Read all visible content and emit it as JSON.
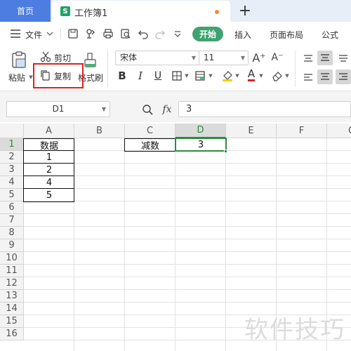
{
  "tabs": {
    "home": "首页",
    "doc_title": "工作簿1",
    "doc_logo": "S",
    "add": "+"
  },
  "menu": {
    "file": "文件",
    "start": "开始",
    "insert": "插入",
    "page_layout": "页面布局",
    "formula": "公式"
  },
  "ribbon": {
    "paste": "粘贴",
    "cut": "剪切",
    "copy": "复制",
    "format_painter": "格式刷",
    "font_name": "宋体",
    "font_size": "11",
    "bold": "B",
    "italic": "I",
    "underline": "U",
    "font_color": "A",
    "grow_font": "A⁺",
    "shrink_font": "A⁻"
  },
  "formula_bar": {
    "name_box": "D1",
    "fx": "fx",
    "value": "3"
  },
  "columns": [
    "A",
    "B",
    "C",
    "D",
    "E",
    "F",
    "G"
  ],
  "rows": [
    "1",
    "2",
    "3",
    "4",
    "5",
    "6",
    "7",
    "8",
    "9",
    "10",
    "11",
    "12",
    "13",
    "14",
    "15",
    "16"
  ],
  "cells": {
    "A1": "数据",
    "A2": "1",
    "A3": "2",
    "A4": "4",
    "A5": "5",
    "C1": "减数",
    "D1": "3"
  },
  "colors": {
    "accent": "#3fa36f",
    "tab_blue": "#4d7de0",
    "highlight_red": "#e02020",
    "selection_green": "#2e8b3e"
  },
  "watermark": "软件技巧"
}
